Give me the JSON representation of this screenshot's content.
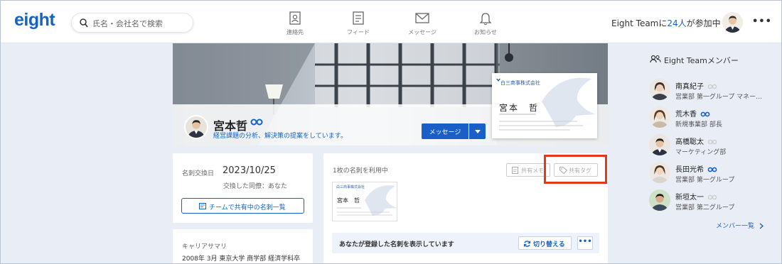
{
  "header": {
    "logo": "eight",
    "search_placeholder": "氏名・会社名で検索",
    "nav": [
      {
        "label": "連絡先",
        "icon": "contacts-icon"
      },
      {
        "label": "フィード",
        "icon": "feed-icon"
      },
      {
        "label": "メッセージ",
        "icon": "mail-icon"
      },
      {
        "label": "お知らせ",
        "icon": "bell-icon"
      }
    ],
    "team_prefix": "Eight Teamに",
    "team_count": "24人",
    "team_suffix": "が参加中",
    "more": "•••"
  },
  "profile": {
    "name": "宮本哲",
    "tagline": "経営課題の分析、解決策の提案をしています。",
    "message_button": "メッセージ",
    "card": {
      "company": "白三商事株式会社",
      "name": "宮本　哲"
    }
  },
  "exchange": {
    "date_label": "名刺交換日",
    "date": "2023/10/25",
    "exchanged_by": "交換した同僚：あなた",
    "shared_button": "チームで共有中の名刺一覧"
  },
  "career": {
    "title": "キャリアサマリ",
    "text": "2008年 3月 東京大学 商学部 経済学科卒"
  },
  "cards_panel": {
    "uses_text": "1枚の名刺を利用中",
    "share_memo": "共有メモ",
    "share_tag": "共有タグ",
    "small_card_company": "白三商事株式会社",
    "small_card_name": "宮本　哲",
    "registered_text": "あなたが登録した名刺を表示しています",
    "switch_button": "切り替える",
    "more_button": "•••"
  },
  "members": {
    "title": "Eight Teamメンバー",
    "list": [
      {
        "name": "南真紀子",
        "dept": "営業部 第一グループ マネー…",
        "premium": false
      },
      {
        "name": "荒木香",
        "dept": "新規事業部 部長",
        "premium": true
      },
      {
        "name": "高橋聡太",
        "dept": "マーケティング部",
        "premium": false
      },
      {
        "name": "長田光希",
        "dept": "営業部 第一グループ",
        "premium": true
      },
      {
        "name": "新垣太一",
        "dept": "営業部 第二グループ",
        "premium": false
      }
    ],
    "see_all": "メンバー一覧"
  },
  "colors": {
    "brand": "#1663c4",
    "highlight": "#e0391c",
    "background": "#e9eef6"
  }
}
